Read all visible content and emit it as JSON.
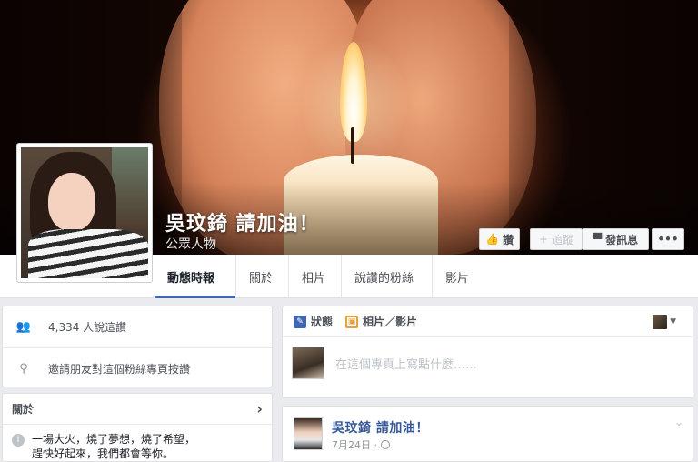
{
  "cover": {
    "page_name": "吳玟錡 請加油！",
    "category": "公眾人物",
    "buttons": {
      "like_label": "讚",
      "follow_label": "追蹤",
      "message_label": "發訊息",
      "more_label": "•••"
    }
  },
  "nav": {
    "tabs": [
      {
        "label": "動態時報",
        "active": true
      },
      {
        "label": "關於"
      },
      {
        "label": "相片"
      },
      {
        "label": "說讚的粉絲"
      },
      {
        "label": "影片"
      }
    ]
  },
  "left": {
    "likes_count": "4,334 人說這讚",
    "invite_text": "邀請朋友對這個粉絲專頁按讚",
    "about_title": "關於",
    "about_text_1": "一場大火，燒了夢想，燒了希望，",
    "about_text_2": "趕快好起來，我們都會等你。"
  },
  "composer": {
    "tab_status": "狀態",
    "tab_photo": "相片／影片",
    "placeholder": "在這個專頁上寫點什麼……"
  },
  "post": {
    "author": "吳玟錡 請加油！",
    "date": "7月24日 ·"
  },
  "colors": {
    "accent": "#4267b2",
    "link": "#365899",
    "background": "#e9ebee"
  },
  "icons": [
    "like-icon",
    "plus-icon",
    "message-icon",
    "people-icon",
    "invite-icon",
    "chevron-right-icon",
    "info-icon",
    "status-icon",
    "photo-icon",
    "caret-down-icon",
    "globe-icon",
    "chevron-down-icon"
  ]
}
